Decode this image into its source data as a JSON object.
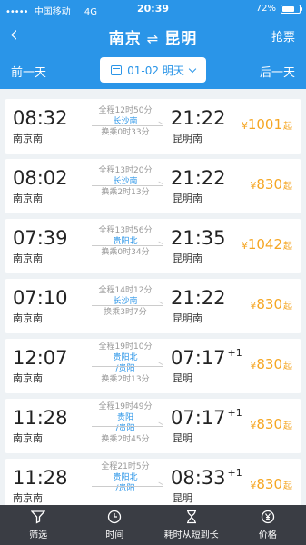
{
  "statusbar": {
    "signal_dots": "•••••",
    "carrier": "中国移动",
    "network": "4G",
    "time": "20:39",
    "battery_percent": "72%",
    "battery_level": 0.72
  },
  "navbar": {
    "from": "南京",
    "swap": "⇌",
    "to": "昆明",
    "grab_ticket": "抢票"
  },
  "datebar": {
    "prev_day": "前一天",
    "date": "01-02 明天",
    "next_day": "后一天"
  },
  "trains": [
    {
      "dep_time": "08:32",
      "dep_station": "南京南",
      "duration": "全程12时50分",
      "via": "长沙南",
      "change": "换乘0时33分",
      "arr_time": "21:22",
      "arr_day": "",
      "arr_station": "昆明南",
      "price": "1001"
    },
    {
      "dep_time": "08:02",
      "dep_station": "南京南",
      "duration": "全程13时20分",
      "via": "长沙南",
      "change": "换乘2时13分",
      "arr_time": "21:22",
      "arr_day": "",
      "arr_station": "昆明南",
      "price": "830"
    },
    {
      "dep_time": "07:39",
      "dep_station": "南京南",
      "duration": "全程13时56分",
      "via": "贵阳北",
      "change": "换乘0时34分",
      "arr_time": "21:35",
      "arr_day": "",
      "arr_station": "昆明南",
      "price": "1042"
    },
    {
      "dep_time": "07:10",
      "dep_station": "南京南",
      "duration": "全程14时12分",
      "via": "长沙南",
      "change": "换乘3时7分",
      "arr_time": "21:22",
      "arr_day": "",
      "arr_station": "昆明南",
      "price": "830"
    },
    {
      "dep_time": "12:07",
      "dep_station": "南京南",
      "duration": "全程19时10分",
      "via": "贵阳北",
      "via2": "/贵阳",
      "change": "换乘2时13分",
      "arr_time": "07:17",
      "arr_day": "+1",
      "arr_station": "昆明",
      "price": "830"
    },
    {
      "dep_time": "11:28",
      "dep_station": "南京南",
      "duration": "全程19时49分",
      "via": "贵阳",
      "via2": "/贵阳",
      "change": "换乘2时45分",
      "arr_time": "07:17",
      "arr_day": "+1",
      "arr_station": "昆明",
      "price": "830"
    },
    {
      "dep_time": "11:28",
      "dep_station": "南京南",
      "duration": "全程21时5分",
      "via": "贵阳北",
      "via2": "/贵阳",
      "change": "",
      "arr_time": "08:33",
      "arr_day": "+1",
      "arr_station": "昆明",
      "price": "830"
    }
  ],
  "currency_symbol": "¥",
  "price_suffix": "起",
  "tabbar": {
    "filter": "筛选",
    "time": "时间",
    "duration_sort": "耗时从短到长",
    "price": "价格"
  },
  "colors": {
    "accent": "#2a95e8",
    "price": "#f5a623",
    "tabbar": "#3a3d44"
  }
}
